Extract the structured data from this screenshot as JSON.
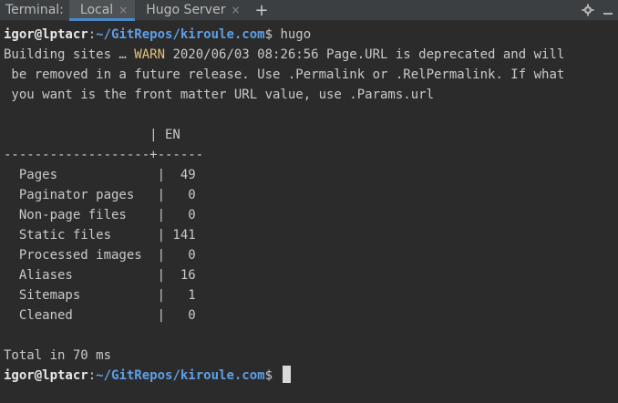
{
  "tabs": {
    "title": "Terminal:",
    "items": [
      {
        "label": "Local",
        "close": "×"
      },
      {
        "label": "Hugo Server",
        "close": "×"
      }
    ],
    "add": "+",
    "settings_icon": "gear-icon",
    "hide_icon": "minimize-icon"
  },
  "terminal": {
    "prompt1": {
      "user": "igor@lptacr",
      "sep": ":",
      "path": "~/GitRepos/kiroule.com",
      "suffix": "$ hugo"
    },
    "build_1a": "Building sites … ",
    "warn": "WARN",
    "build_1b": " 2020/06/03 08:26:56 Page.URL is deprecated and will",
    "build_2": " be removed in a future release. Use .Permalink or .RelPermalink. If what",
    "build_3": " you want is the front matter URL value, use .Params.url",
    "header": "                   | EN",
    "divider": "-------------------+------",
    "stats": [
      "  Pages             |  49",
      "  Paginator pages   |   0",
      "  Non-page files    |   0",
      "  Static files      | 141",
      "  Processed images  |   0",
      "  Aliases           |  16",
      "  Sitemaps          |   1",
      "  Cleaned           |   0"
    ],
    "total": "Total in 70 ms",
    "prompt2": {
      "user": "igor@lptacr",
      "sep": ":",
      "path": "~/GitRepos/kiroule.com",
      "suffix": "$ "
    }
  }
}
